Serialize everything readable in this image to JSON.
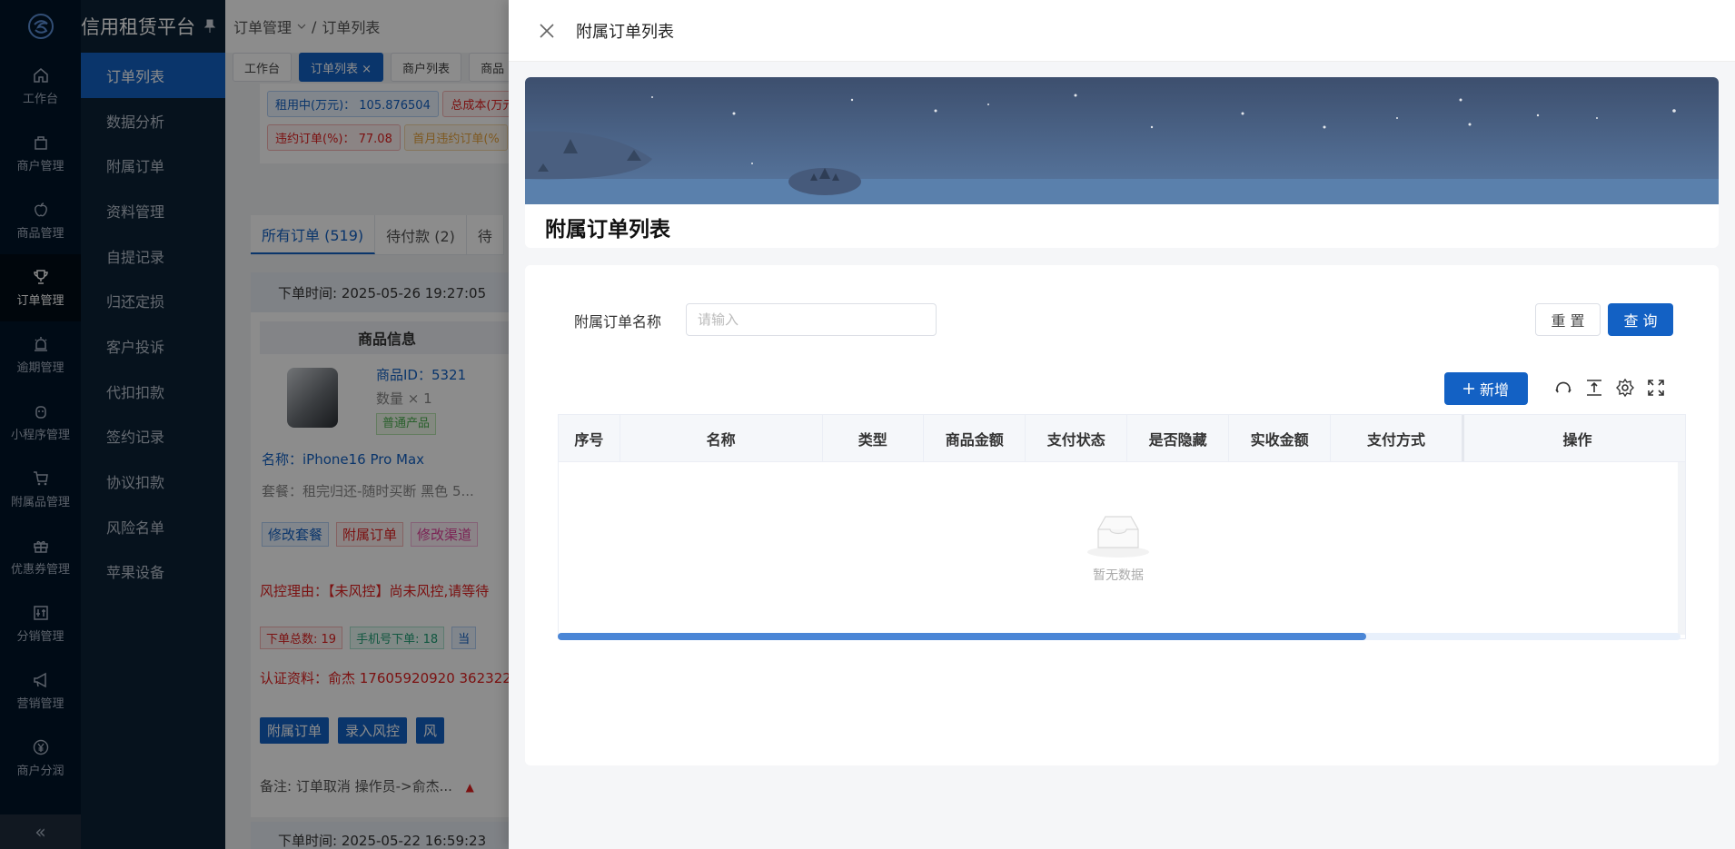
{
  "app": {
    "title": "信用租赁平台"
  },
  "rail": {
    "items": [
      {
        "label": "工作台",
        "icon": "home-icon"
      },
      {
        "label": "商户管理",
        "icon": "bag-icon"
      },
      {
        "label": "商品管理",
        "icon": "apple-icon"
      },
      {
        "label": "订单管理",
        "icon": "trophy-icon",
        "active": true
      },
      {
        "label": "逾期管理",
        "icon": "alarm-icon"
      },
      {
        "label": "小程序管理",
        "icon": "robot-icon"
      },
      {
        "label": "附属品管理",
        "icon": "cart-icon"
      },
      {
        "label": "优惠券管理",
        "icon": "gift-icon"
      },
      {
        "label": "分销管理",
        "icon": "sliders-icon"
      },
      {
        "label": "营销管理",
        "icon": "megaphone-icon"
      },
      {
        "label": "商户分润",
        "icon": "yen-icon"
      }
    ],
    "collapse": "«"
  },
  "submenu": {
    "items": [
      "订单列表",
      "数据分析",
      "附属订单",
      "资料管理",
      "自提记录",
      "归还定损",
      "客户投诉",
      "代扣扣款",
      "签约记录",
      "协议扣款",
      "风险名单",
      "苹果设备"
    ]
  },
  "bg": {
    "breadcrumb": [
      "订单管理",
      "/",
      "订单列表"
    ],
    "tabs": [
      "工作台",
      "订单列表 ×",
      "商户列表",
      "商品"
    ],
    "stats": [
      {
        "text": "租用中(万元)： 105.876504",
        "kind": "blue"
      },
      {
        "text": "总成本(万元",
        "kind": "red"
      },
      {
        "text": "违约订单(%)： 77.08",
        "kind": "red"
      },
      {
        "text": "首月违约订单(%",
        "kind": "orange"
      }
    ],
    "order_tabs": [
      "所有订单 (519)",
      "待付款 (2)",
      "待"
    ],
    "order": {
      "time": "下单时间: 2025-05-26 19:27:05",
      "product_header": "商品信息",
      "product_id": "商品ID：5321",
      "quantity": "数量 × 1",
      "type_tag": "普通产品",
      "name": "名称：iPhone16 Pro Max",
      "package": "套餐：租完归还-随时买断 黑色 5...",
      "actions": [
        "修改套餐",
        "附属订单",
        "修改渠道"
      ],
      "risk": "风控理由：【未风控】尚未风控,请等待",
      "chips": [
        {
          "text": "下单总数: 19",
          "kind": "red"
        },
        {
          "text": "手机号下单: 18",
          "kind": "green"
        },
        {
          "text": "当",
          "kind": "blue"
        }
      ],
      "cert": "认证资料：俞杰  17605920920  362322",
      "buttons": [
        "附属订单",
        "录入风控",
        "风"
      ],
      "note": "备注: 订单取消 操作员->俞杰...",
      "next_time": "下单时间: 2025-05-22 16:59:23"
    }
  },
  "drawer": {
    "title": "附属订单列表",
    "banner_title": "附属订单列表",
    "filter": {
      "label": "附属订单名称",
      "placeholder": "请输入",
      "value": ""
    },
    "reset_label": "重 置",
    "query_label": "查 询",
    "add_label": "新增",
    "columns": [
      "序号",
      "名称",
      "类型",
      "商品金额",
      "支付状态",
      "是否隐藏",
      "实收金额",
      "支付方式",
      "操作"
    ],
    "rows": [],
    "empty_text": "暂无数据",
    "hscroll_fraction": 0.72
  }
}
